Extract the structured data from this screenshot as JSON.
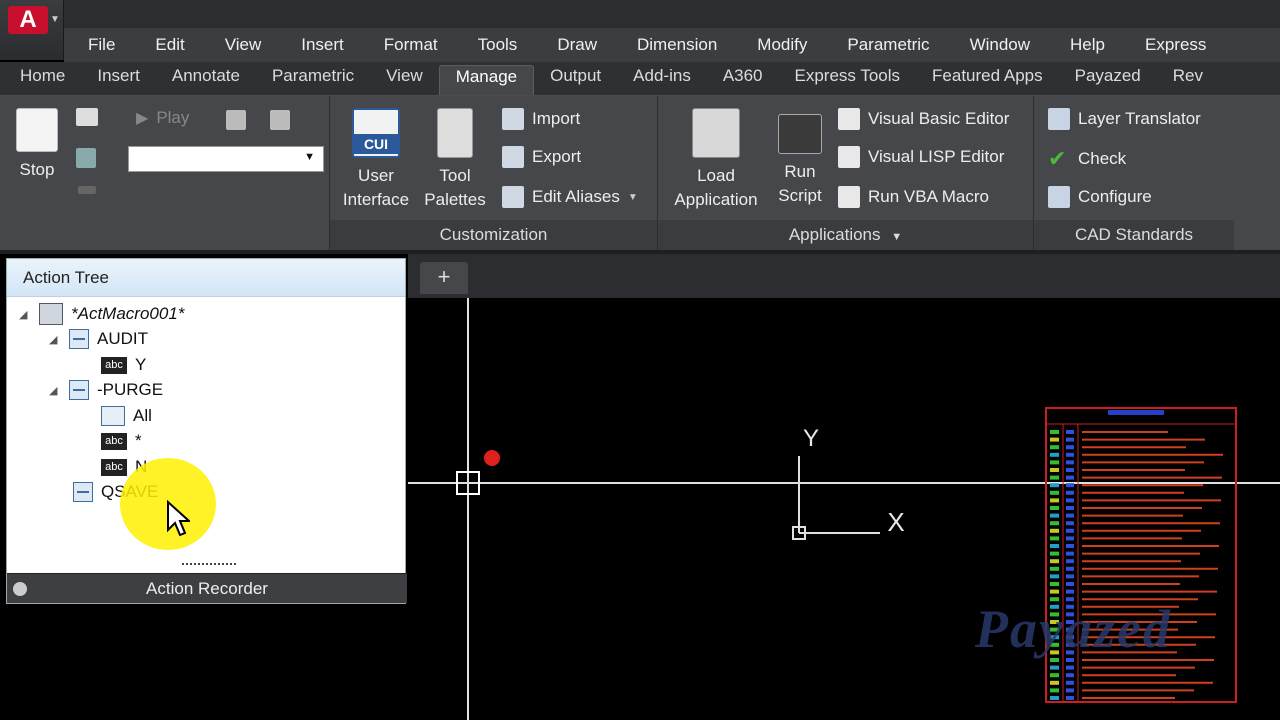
{
  "menubar": [
    "File",
    "Edit",
    "View",
    "Insert",
    "Format",
    "Tools",
    "Draw",
    "Dimension",
    "Modify",
    "Parametric",
    "Window",
    "Help",
    "Express"
  ],
  "tabs": [
    "Home",
    "Insert",
    "Annotate",
    "Parametric",
    "View",
    "Manage",
    "Output",
    "Add-ins",
    "A360",
    "Express Tools",
    "Featured Apps",
    "Payazed",
    "Rev"
  ],
  "active_tab": "Manage",
  "ribbon": {
    "stop": "Stop",
    "play": "Play",
    "user_interface": [
      "User",
      "Interface"
    ],
    "tool_palettes": [
      "Tool",
      "Palettes"
    ],
    "import": "Import",
    "export": "Export",
    "edit_aliases": "Edit Aliases",
    "customization": "Customization",
    "load_application": [
      "Load",
      "Application"
    ],
    "run_script": [
      "Run",
      "Script"
    ],
    "vb_editor": "Visual Basic Editor",
    "vlisp_editor": "Visual LISP Editor",
    "run_vba": "Run VBA Macro",
    "applications": "Applications",
    "layer_translator": "Layer Translator",
    "check": "Check",
    "configure": "Configure",
    "cad_standards": "CAD Standards",
    "cui_badge": "CUI"
  },
  "action_tree": {
    "title": "Action Tree",
    "macro": "*ActMacro001*",
    "nodes": {
      "audit": "AUDIT",
      "audit_y": "Y",
      "purge": "-PURGE",
      "purge_all": "All",
      "purge_star": "*",
      "purge_n": "N",
      "qsave": "QSAVE"
    },
    "footer": "Action Recorder"
  },
  "canvas": {
    "axis_y": "Y",
    "axis_x": "X",
    "tab_add": "+"
  },
  "watermark": "Payazed",
  "colors": {
    "accent": "#c8102e",
    "marker": "#e0201c",
    "highlight": "#ffee00"
  }
}
